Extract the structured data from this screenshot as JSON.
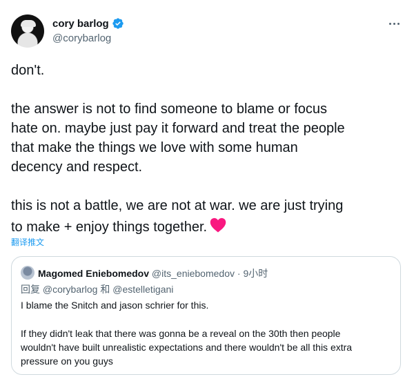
{
  "author": {
    "display_name": "cory barlog",
    "handle": "@corybarlog",
    "verified": true
  },
  "tweet": {
    "paragraphs": [
      [
        "don't."
      ],
      [
        "the answer is not to find someone to blame or focus",
        "hate on. maybe just pay it forward and treat the people",
        "that make the things we love with some human",
        "decency and respect."
      ],
      [
        "this is not a battle, we are not at war. we are just trying",
        "to make + enjoy things together."
      ]
    ],
    "translate_label": "翻译推文"
  },
  "quoted_tweet": {
    "author_name": "Magomed Eniebomedov",
    "handle": "@its_eniebomedov",
    "separator": "·",
    "time": "9小时",
    "reply_prefix": "回复",
    "reply_mention_1": "@corybarlog",
    "reply_conjunction": "和",
    "reply_mention_2": "@estelletigani",
    "lines": [
      "I blame the Snitch and jason schrier for this.",
      "If they didn't leak that there was gonna be a reveal on the 30th then people",
      "wouldn't have built unrealistic expectations and there wouldn't be all this extra",
      "pressure on you guys"
    ]
  },
  "colors": {
    "text_primary": "#0f1419",
    "text_secondary": "#536471",
    "accent": "#1d9bf0",
    "heart": "#f91880",
    "border": "#cfd9de"
  },
  "icons": [
    "verified-badge-icon",
    "more-options-icon",
    "red-heart-emoji-icon"
  ]
}
